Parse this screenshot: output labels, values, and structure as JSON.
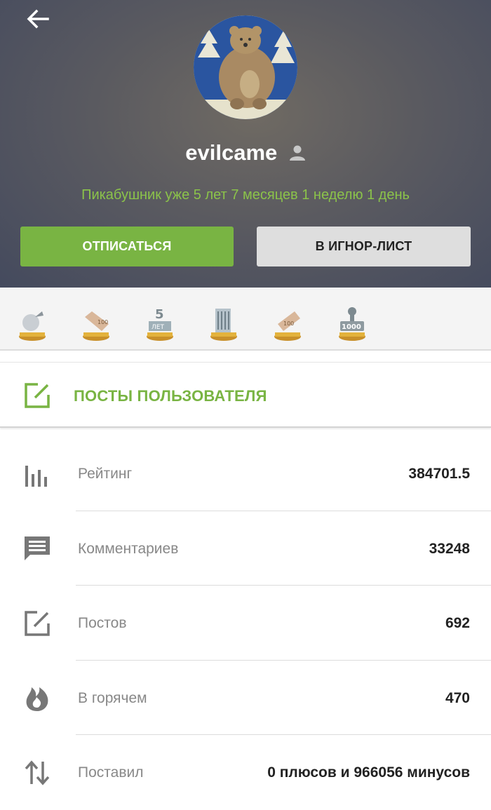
{
  "header": {
    "username": "evilcame",
    "tenure": "Пикабушник уже 5 лет 7 месяцев 1 неделю 1 день",
    "unsubscribe_label": "ОТПИСАТЬСЯ",
    "ignore_label": "В ИГНОР-ЛИСТ"
  },
  "awards": [
    {
      "icon": "award-apple-icon"
    },
    {
      "icon": "award-100-tag-icon",
      "text": "100"
    },
    {
      "icon": "award-5-years-icon",
      "text": "5 ЛЕТ"
    },
    {
      "icon": "award-building-icon"
    },
    {
      "icon": "award-100-ticket-icon",
      "text": "100"
    },
    {
      "icon": "award-1000-icon",
      "text": "1000"
    }
  ],
  "posts_link": {
    "label": "ПОСТЫ ПОЛЬЗОВАТЕЛЯ"
  },
  "stats": [
    {
      "icon": "rating-bars-icon",
      "label": "Рейтинг",
      "value": "384701.5"
    },
    {
      "icon": "comment-icon",
      "label": "Комментариев",
      "value": "33248"
    },
    {
      "icon": "edit-post-icon",
      "label": "Постов",
      "value": "692"
    },
    {
      "icon": "flame-icon",
      "label": "В горячем",
      "value": "470"
    },
    {
      "icon": "up-down-arrows-icon",
      "label": "Поставил",
      "value": "0 плюсов и 966056 минусов"
    }
  ],
  "colors": {
    "accent_green": "#79b443",
    "tenure_green": "#8bc34a",
    "icon_gray": "#777777"
  }
}
